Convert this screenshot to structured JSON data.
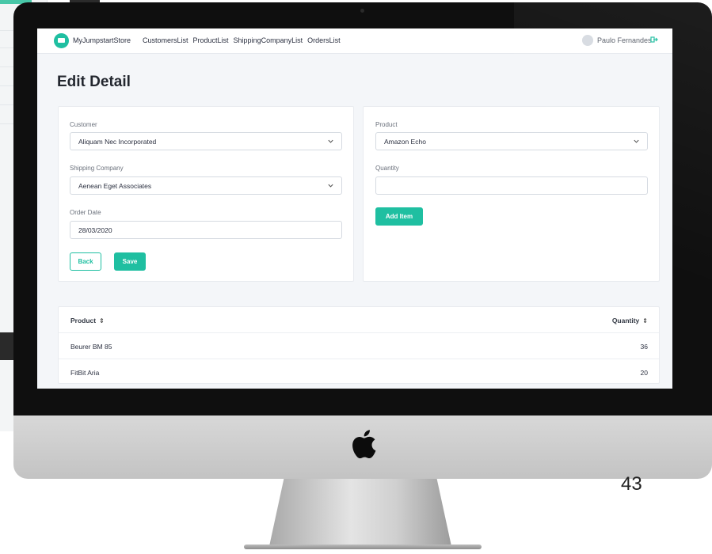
{
  "app": {
    "brand": "MyJumpstartStore",
    "nav_links": [
      "CustomersList",
      "ProductList",
      "ShippingCompanyList",
      "OrdersList"
    ],
    "user_name": "Paulo Fernandes"
  },
  "page": {
    "title": "Edit Detail"
  },
  "left_form": {
    "customer_label": "Customer",
    "customer_value": "Aliquam Nec Incorporated",
    "shipping_label": "Shipping Company",
    "shipping_value": "Aenean Eget Associates",
    "order_date_label": "Order Date",
    "order_date_value": "28/03/2020",
    "back_label": "Back",
    "save_label": "Save"
  },
  "right_form": {
    "product_label": "Product",
    "product_value": "Amazon Echo",
    "quantity_label": "Quantity",
    "quantity_value": "",
    "add_item_label": "Add Item"
  },
  "table": {
    "columns": [
      "Product",
      "Quantity"
    ],
    "rows": [
      {
        "product": "Beurer BM 85",
        "quantity": "36"
      },
      {
        "product": "FitBit Aria",
        "quantity": "20"
      }
    ]
  },
  "slide": {
    "number": "43"
  },
  "colors": {
    "accent": "#1fbfa1",
    "bezel": "#0f0f0f",
    "screen_bg": "#f4f6f9"
  },
  "icons": {
    "logo": "store-logo-icon",
    "chevron": "chevron-down-icon",
    "sort": "sort-icon",
    "logout": "logout-icon",
    "apple": "apple-logo-icon"
  }
}
